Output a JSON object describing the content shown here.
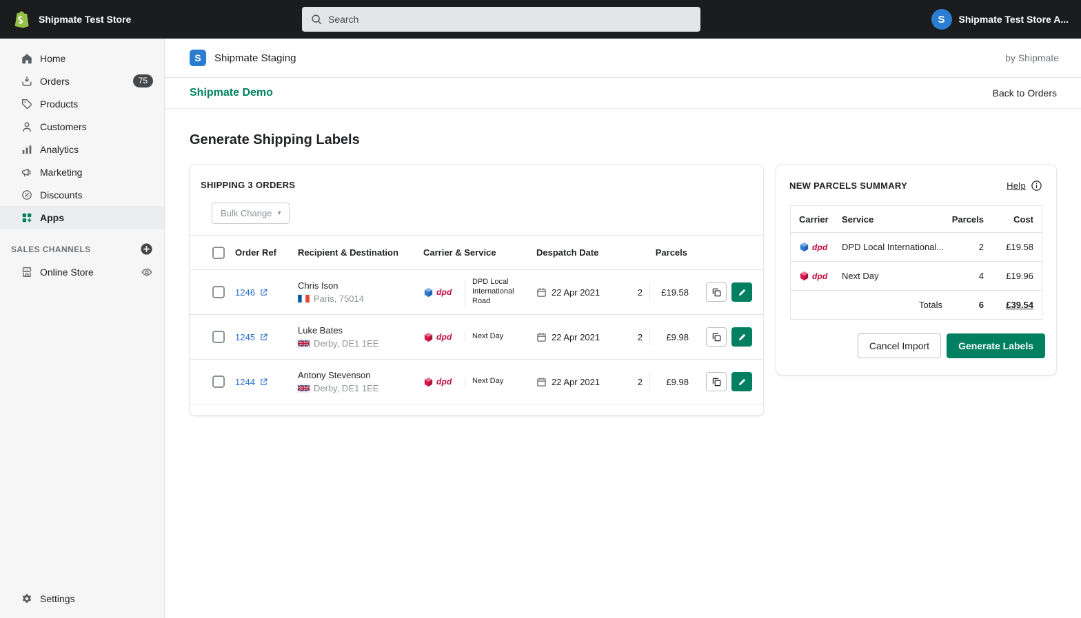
{
  "topbar": {
    "store_name": "Shipmate Test Store",
    "search_placeholder": "Search",
    "account_name": "Shipmate Test Store A...",
    "avatar_initial": "S"
  },
  "sidebar": {
    "items": [
      {
        "label": "Home"
      },
      {
        "label": "Orders",
        "badge": "75"
      },
      {
        "label": "Products"
      },
      {
        "label": "Customers"
      },
      {
        "label": "Analytics"
      },
      {
        "label": "Marketing"
      },
      {
        "label": "Discounts"
      },
      {
        "label": "Apps",
        "active": true
      }
    ],
    "sales_channels_label": "SALES CHANNELS",
    "online_store_label": "Online Store",
    "settings_label": "Settings"
  },
  "app_header": {
    "title": "Shipmate Staging",
    "byline": "by Shipmate",
    "logo_initial": "S"
  },
  "sub_header": {
    "title": "Shipmate Demo",
    "back_link": "Back to Orders"
  },
  "page_title": "Generate Shipping Labels",
  "orders_card": {
    "title": "SHIPPING 3 ORDERS",
    "bulk_change_label": "Bulk Change",
    "dpd_wordmark": "dpd",
    "columns": {
      "order_ref": "Order Ref",
      "recipient": "Recipient & Destination",
      "carrier": "Carrier & Service",
      "despatch": "Despatch Date",
      "parcels": "Parcels"
    },
    "rows": [
      {
        "order_ref": "1246",
        "recipient": "Chris Ison",
        "flag": "fr",
        "destination": "Paris, 75014",
        "carrier_cube": "blue",
        "service": "DPD Local International Road",
        "despatch_date": "22 Apr 2021",
        "parcels": "2",
        "cost": "£19.58"
      },
      {
        "order_ref": "1245",
        "recipient": "Luke Bates",
        "flag": "gb",
        "destination": "Derby, DE1 1EE",
        "carrier_cube": "red",
        "service": "Next Day",
        "despatch_date": "22 Apr 2021",
        "parcels": "2",
        "cost": "£9.98"
      },
      {
        "order_ref": "1244",
        "recipient": "Antony Stevenson",
        "flag": "gb",
        "destination": "Derby, DE1 1EE",
        "carrier_cube": "red",
        "service": "Next Day",
        "despatch_date": "22 Apr 2021",
        "parcels": "2",
        "cost": "£9.98"
      }
    ]
  },
  "summary_card": {
    "title": "NEW PARCELS SUMMARY",
    "help_label": "Help",
    "dpd_wordmark": "dpd",
    "columns": {
      "carrier": "Carrier",
      "service": "Service",
      "parcels": "Parcels",
      "cost": "Cost"
    },
    "rows": [
      {
        "carrier_cube": "blue",
        "service": "DPD Local International...",
        "parcels": "2",
        "cost": "£19.58"
      },
      {
        "carrier_cube": "red",
        "service": "Next Day",
        "parcels": "4",
        "cost": "£19.96"
      }
    ],
    "totals_label": "Totals",
    "totals_parcels": "6",
    "totals_cost": "£39.54",
    "cancel_button": "Cancel Import",
    "generate_button": "Generate Labels"
  },
  "colors": {
    "accent_green": "#008060",
    "link_blue": "#2c6ecb",
    "dpd_red": "#c00a3a",
    "cube_blue": "#2e7cd6",
    "cube_red": "#d9174b",
    "shipmate_blue": "#2b7dd1",
    "topbar_bg": "#1a1c1d",
    "sidebar_bg": "#f6f6f7"
  }
}
